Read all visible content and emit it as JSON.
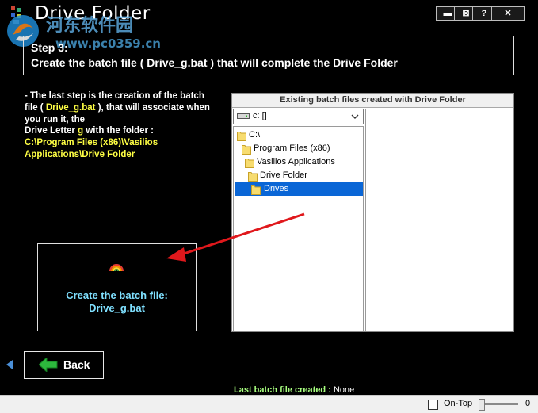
{
  "window": {
    "title": "Drive Folder",
    "buttons": {
      "minimize": "▬",
      "maximize": "⊠",
      "help": "?",
      "close": "✕"
    }
  },
  "watermark": {
    "text1": "河东软件园",
    "text2": "www.pc0359.cn"
  },
  "step": {
    "title": "Step 3:",
    "description": "Create the batch file ( Drive_g.bat ) that will complete the Drive Folder"
  },
  "info": {
    "line1": "- The last step is the creation of the batch",
    "file_prefix": "file (",
    "file_name": "Drive_g.bat",
    "file_suffix": "), that will associate when",
    "line3": "you run it, the",
    "drive_letter_prefix": "Drive Letter",
    "drive_letter": "g",
    "drive_letter_suffix": "with the folder :",
    "folder_path": "C:\\Program Files (x86)\\Vasilios Applications\\Drive Folder"
  },
  "existing_panel": {
    "header": "Existing batch files created with Drive Folder",
    "drive": "c: []",
    "dirs": [
      "C:\\",
      "Program Files (x86)",
      "Vasilios Applications",
      "Drive Folder",
      "Drives"
    ],
    "selected_dir": "Drives"
  },
  "create_button": {
    "line1": "Create the batch file:",
    "line2": "Drive_g.bat"
  },
  "back_button": {
    "label": "Back"
  },
  "footer": {
    "last_batch_label": "Last batch file created :",
    "last_batch_value": "None"
  },
  "statusbar": {
    "ontop_label": "On-Top",
    "ontop_checked": false,
    "slider_value": "0"
  },
  "colors": {
    "accent_yellow": "#ffff44",
    "create_text": "#7fe0ff",
    "footer_label": "#a8ff7f",
    "selection": "#0a66d6",
    "arrow": "#e0181c"
  }
}
